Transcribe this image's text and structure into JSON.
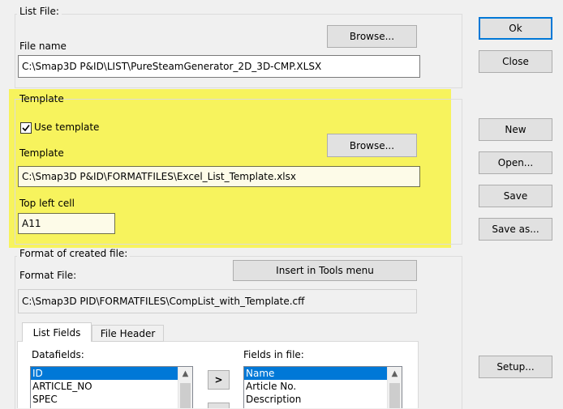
{
  "list_file": {
    "group_label": "List File:",
    "file_name_label": "File name",
    "browse_label": "Browse...",
    "file_name_value": "C:\\Smap3D P&ID\\LIST\\PureSteamGenerator_2D_3D-CMP.XLSX"
  },
  "template": {
    "group_label": "Template",
    "use_template_label": "Use template",
    "use_template_checked": true,
    "template_label": "Template",
    "browse_label": "Browse...",
    "template_value": "C:\\Smap3D P&ID\\FORMATFILES\\Excel_List_Template.xlsx",
    "top_left_cell_label": "Top left cell",
    "top_left_cell_value": "A11"
  },
  "format": {
    "group_label": "Format of created file:",
    "format_file_label": "Format File:",
    "insert_tools_label": "Insert in Tools menu",
    "format_file_value": "C:\\Smap3D PID\\FORMATFILES\\CompList_with_Template.cff"
  },
  "tabs": [
    "List Fields",
    "File Header"
  ],
  "datafields": {
    "label": "Datafields:",
    "items": [
      "ID",
      "ARTICLE_NO",
      "SPEC"
    ]
  },
  "move_right_label": ">",
  "fields_in_file": {
    "label": "Fields in file:",
    "items": [
      "Name",
      "Article No.",
      "Description"
    ]
  },
  "buttons": {
    "ok": "Ok",
    "close": "Close",
    "new": "New",
    "open": "Open...",
    "save": "Save",
    "save_as": "Save as...",
    "setup": "Setup..."
  },
  "colors": {
    "highlight": "#f8f33c",
    "selection": "#0078d7",
    "accent_border": "#0078d7"
  }
}
